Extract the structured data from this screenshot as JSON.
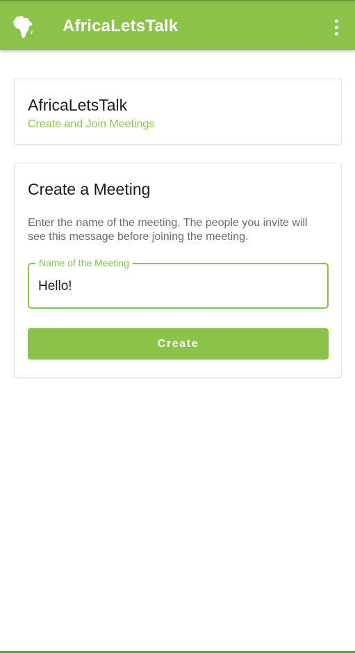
{
  "app_bar": {
    "title": "AfricaLetsTalk",
    "logo_icon": "africa-map-icon",
    "menu_icon": "more-vert-icon",
    "color": "#8bc34a"
  },
  "info_card": {
    "title": "AfricaLetsTalk",
    "subtitle": "Create and Join Meetings"
  },
  "create_card": {
    "title": "Create a Meeting",
    "description": "Enter the name of the meeting. The people you invite will see this message before joining the meeting.",
    "field": {
      "label": "Name of the Meeting",
      "value": "Hello!"
    },
    "button_label": "Create"
  },
  "colors": {
    "accent": "#8bc34a",
    "text_primary": "#1a1a1a",
    "text_secondary": "#6b6b6b"
  }
}
